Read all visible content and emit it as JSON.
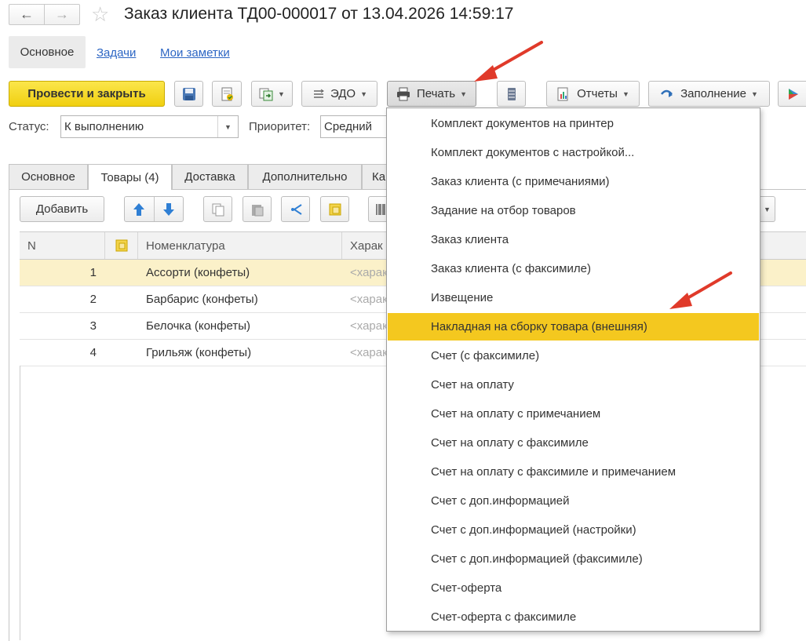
{
  "window": {
    "title": "Заказ клиента ТД00-000017 от 13.04.2026 14:59:17",
    "back_icon": "arrow-left-icon",
    "forward_icon": "arrow-right-icon",
    "favorite_icon": "star-icon"
  },
  "sections": {
    "main": "Основное",
    "tasks": "Задачи",
    "notes": "Мои заметки"
  },
  "toolbar": {
    "post_close": "Провести и закрыть",
    "edo": "ЭДО",
    "print": "Печать",
    "reports": "Отчеты",
    "fill": "Заполнение"
  },
  "status_row": {
    "status_label": "Статус:",
    "status_value": "К выполнению",
    "priority_label": "Приоритет:",
    "priority_value": "Средний"
  },
  "tabs": [
    {
      "label": "Основное"
    },
    {
      "label": "Товары (4)"
    },
    {
      "label": "Доставка"
    },
    {
      "label": "Дополнительно"
    },
    {
      "label": "Ка"
    }
  ],
  "table_toolbar": {
    "add": "Добавить"
  },
  "table": {
    "columns": [
      "N",
      "Номенклатура",
      "Харак"
    ],
    "rows": [
      {
        "n": "1",
        "name": "Ассорти (конфеты)",
        "char": "<харак"
      },
      {
        "n": "2",
        "name": "Барбарис (конфеты)",
        "char": "<харак"
      },
      {
        "n": "3",
        "name": "Белочка (конфеты)",
        "char": "<харак"
      },
      {
        "n": "4",
        "name": "Грильяж (конфеты)",
        "char": "<харак"
      }
    ]
  },
  "print_menu": {
    "items": [
      "Комплект документов на принтер",
      "Комплект документов с настройкой...",
      "Заказ клиента (с примечаниями)",
      "Задание на отбор товаров",
      "Заказ клиента",
      "Заказ клиента (с факсимиле)",
      "Извещение",
      "Накладная на сборку товара (внешняя)",
      "Счет (с факсимиле)",
      "Счет на оплату",
      "Счет на оплату с примечанием",
      "Счет на оплату с факсимиле",
      "Счет на оплату с факсимиле и примечанием",
      "Счет с доп.информацией",
      "Счет с доп.информацией (настройки)",
      "Счет с доп.информацией (факсимиле)",
      "Счет-оферта",
      "Счет-оферта с факсимиле"
    ],
    "highlighted_index": 7
  },
  "colors": {
    "accent_yellow": "#f4c81f",
    "link_blue": "#2d66c4",
    "annotation_red": "#e03a2a",
    "selected_row": "#fbf1c9"
  }
}
